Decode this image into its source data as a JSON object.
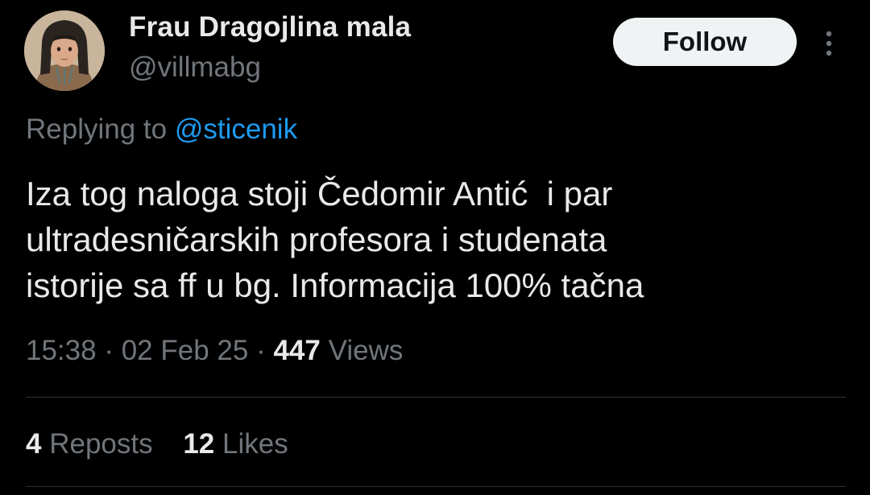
{
  "user": {
    "display_name": "Frau Dragojlina mala",
    "handle": "@villmabg"
  },
  "follow_button": {
    "label": "Follow"
  },
  "more_menu": {
    "icon": "more-vertical-icon"
  },
  "reply": {
    "prefix": "Replying to",
    "to_handle": "@sticenik"
  },
  "tweet": {
    "lines": [
      "Iza tog naloga stoji Čedomir Antić  i par",
      "ultradesničarskih profesora i studenata",
      "istorije sa ff u bg. Informacija 100% tačna"
    ]
  },
  "meta": {
    "time": "15:38",
    "separator": "·",
    "date": "02 Feb 25",
    "views_count": "447",
    "views_label": "Views"
  },
  "stats": {
    "reposts_count": "4",
    "reposts_label": "Reposts",
    "likes_count": "12",
    "likes_label": "Likes"
  },
  "colors": {
    "background": "#000000",
    "text": "#e7e9ea",
    "secondary": "#71767b",
    "link": "#1d9bf0",
    "divider": "#2f3336",
    "button_bg": "#eff3f4"
  }
}
